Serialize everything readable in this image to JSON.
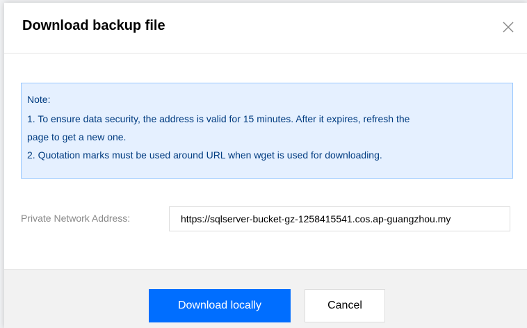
{
  "dialog": {
    "title": "Download backup file",
    "close_icon": "close-icon"
  },
  "note": {
    "heading": "Note:",
    "line1": "1. To ensure data security, the address is valid for 15 minutes. After it expires, refresh the",
    "line2": "page to get a new one.",
    "line3": "2. Quotation marks must be used around URL when wget is used for downloading."
  },
  "address": {
    "label": "Private Network Address:",
    "value": "https://sqlserver-bucket-gz-1258415541.cos.ap-guangzhou.my"
  },
  "footer": {
    "download_label": "Download locally",
    "cancel_label": "Cancel"
  },
  "colors": {
    "primary": "#006eff",
    "note_background": "#e5f0ff",
    "note_border": "#97c7ff",
    "note_text": "#003b80"
  }
}
